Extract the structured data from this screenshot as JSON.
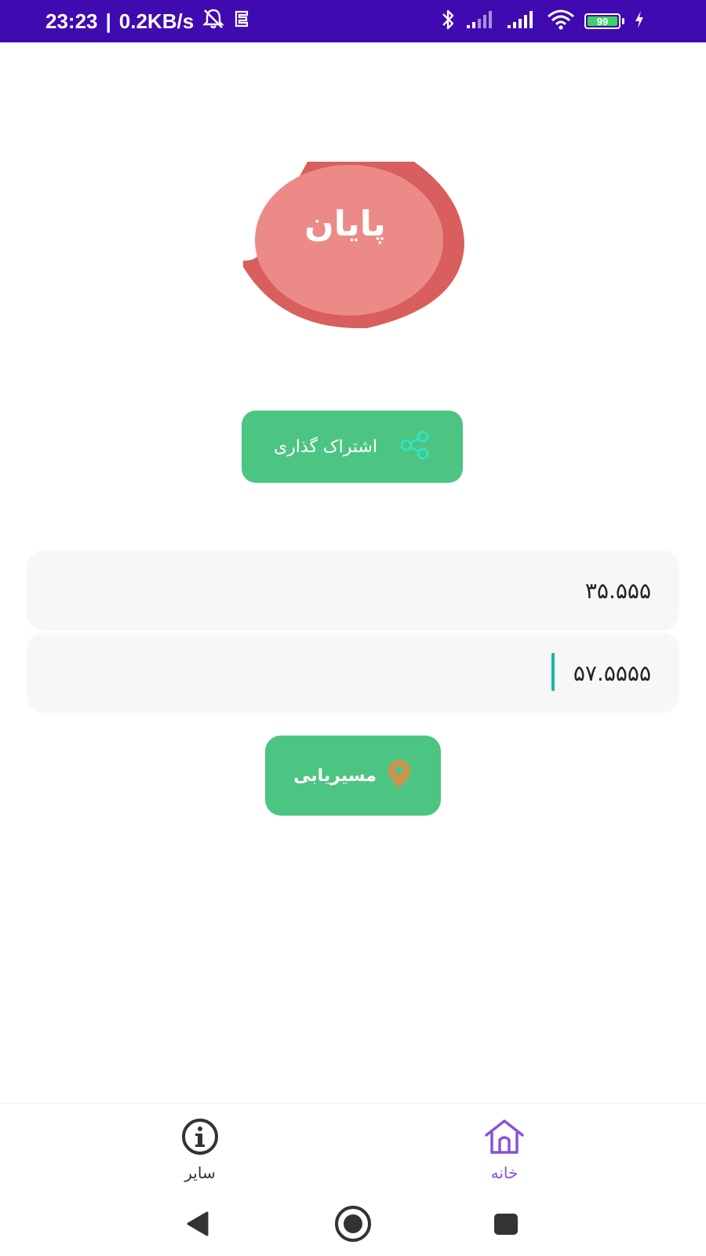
{
  "status_bar": {
    "time": "23:23",
    "separator": "|",
    "net_speed": "0.2KB/s",
    "battery_level": "99",
    "battery_fraction": 0.99,
    "icons": [
      "alarm-off-icon",
      "app-notification-icon",
      "bluetooth-icon",
      "signal-icon",
      "signal-icon",
      "wifi-icon",
      "battery-icon",
      "charging-icon"
    ],
    "color": "#3f0ab0"
  },
  "end_badge": {
    "label": "پایان",
    "fill_color": "#ec8a88",
    "ring_color": "#d95e5e"
  },
  "share": {
    "label": "اشتراک گذاری",
    "icon": "share-icon"
  },
  "coordinates": {
    "latitude_value": "۳۵.۵۵۵",
    "longitude_value": "۵۷.۵۵۵۵"
  },
  "routing": {
    "label": "مسیریابی",
    "icon": "location-pin-icon"
  },
  "bottom_nav": {
    "items": [
      {
        "label": "سایر",
        "icon": "info-icon",
        "active": false
      },
      {
        "label": "خانه",
        "icon": "home-icon",
        "active": true
      }
    ]
  },
  "theme": {
    "accent_green": "#4cc583",
    "active_nav": "#8a50d8"
  }
}
